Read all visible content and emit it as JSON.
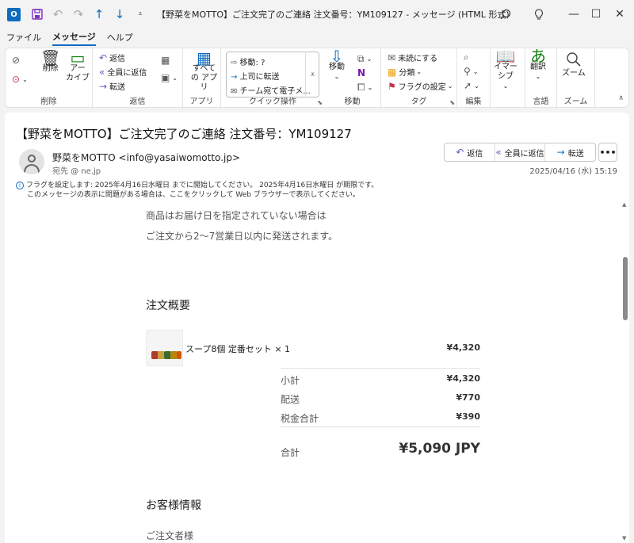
{
  "titlebar": {
    "title": "【野菜をMOTTO】ご注文完了のご連絡  注文番号：YM109127  -  メッセージ (HTML 形式)",
    "app_icon": "outlook-icon"
  },
  "menu": {
    "tabs": [
      "ファイル",
      "メッセージ",
      "ヘルプ"
    ],
    "active": "メッセージ"
  },
  "ribbon": {
    "delete_group": {
      "label": "削除",
      "delete": "削除",
      "archive": "アー\nカイブ"
    },
    "respond_group": {
      "label": "返信",
      "reply": "返信",
      "reply_all": "全員に返信",
      "forward": "転送"
    },
    "apps_group": {
      "label": "アプリ",
      "all_apps": "すべて\nの アプリ"
    },
    "quick_steps_group": {
      "label": "クイック操作",
      "items": [
        "移動: ?",
        "上司に転送",
        "チーム宛て電子メ..."
      ]
    },
    "move_group": {
      "label": "移動",
      "move": "移動"
    },
    "tags_group": {
      "label": "タグ",
      "unread": "未読にする",
      "categorize": "分類",
      "flag": "フラグの設定"
    },
    "editing_group": {
      "label": "編集"
    },
    "immersive_group": {
      "label": "",
      "immersive": "イマー\nシブ"
    },
    "language_group": {
      "label": "言語",
      "translate": "翻訳"
    },
    "zoom_group": {
      "label": "ズーム",
      "zoom": "ズーム"
    }
  },
  "message": {
    "subject": "【野菜をMOTTO】ご注文完了のご連絡  注文番号：YM109127",
    "sender": "野菜をMOTTO <info@yasaiwomotto.jp>",
    "recipient": "宛先          @          ne.jp",
    "datetime": "2025/04/16 (水) 15:19",
    "actions": {
      "reply": "返信",
      "reply_all": "全員に返信",
      "forward": "転送",
      "more": "•••"
    },
    "info_line1": "フラグを設定します:  2025年4月16日水曜日 までに開始してください。  2025年4月16日水曜日 が期限です。",
    "info_line2": "このメッセージの表示に問題がある場合は、ここをクリックして Web ブラウザーで表示してください。"
  },
  "email_body": {
    "line1": "商品はお届け日を指定されていない場合は",
    "line2": "ご注文から2〜7営業日以内に発送されます。",
    "order_summary_title": "注文概要",
    "product_name": "スープ8個 定番セット × 1",
    "product_price": "¥4,320",
    "summary": [
      {
        "label": "小計",
        "value": "¥4,320"
      },
      {
        "label": "配送",
        "value": "¥770"
      },
      {
        "label": "税金合計",
        "value": "¥390"
      }
    ],
    "total_label": "合計",
    "total_value": "¥5,090 JPY",
    "customer_info_title": "お客様情報",
    "orderer_label": "ご注文者様"
  }
}
